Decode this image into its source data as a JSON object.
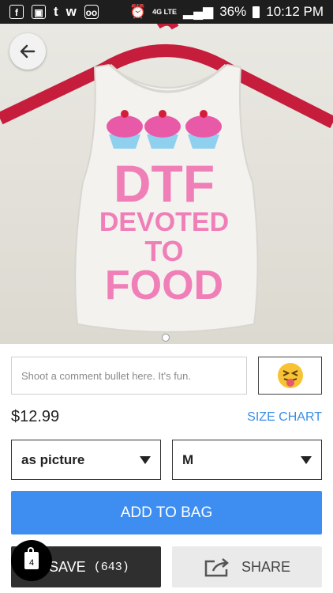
{
  "status_bar": {
    "battery": "36%",
    "time": "10:12 PM",
    "network": "4G LTE"
  },
  "product": {
    "shirt_text_line1": "DTF",
    "shirt_text_line2": "DEVOTED",
    "shirt_text_line3": "TO",
    "shirt_text_line4": "FOOD",
    "price": "$12.99",
    "size_chart_label": "SIZE CHART"
  },
  "comment": {
    "placeholder": "Shoot a comment bullet here. It's fun.",
    "value": ""
  },
  "options": {
    "color_selected": "as picture",
    "size_selected": "M"
  },
  "actions": {
    "add_to_bag_label": "ADD TO BAG",
    "save_label": "SAVE",
    "save_count": "(643)",
    "share_label": "SHARE",
    "bag_count": "4"
  },
  "colors": {
    "accent": "#3d8ef0",
    "pink": "#f07fb8"
  }
}
